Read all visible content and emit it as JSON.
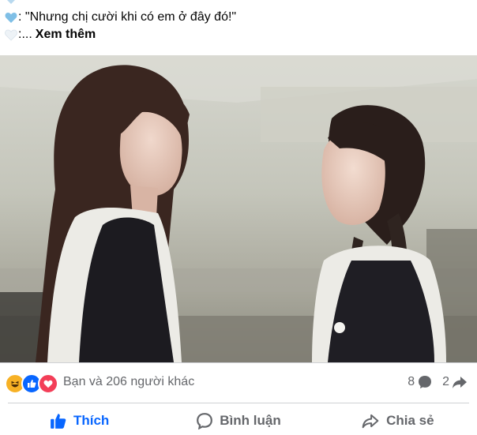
{
  "post": {
    "line1_text": ": \"Nhưng chị cười khi có em ở đây đó!\"",
    "line2_prefix": ":...",
    "see_more": "Xem thêm"
  },
  "reactions": {
    "summary": "Bạn và 206 người khác",
    "icons": [
      "haha-icon",
      "like-icon",
      "love-icon"
    ],
    "comments_count": "8",
    "shares_count": "2"
  },
  "actions": {
    "like": "Thích",
    "comment": "Bình luận",
    "share": "Chia sẻ"
  },
  "colors": {
    "like_blue": "#0866ff",
    "love_red": "#f33e58",
    "haha_yellow": "#f7b125",
    "muted_text": "#65676b",
    "heart_light_blue": "#b8d9ef"
  }
}
